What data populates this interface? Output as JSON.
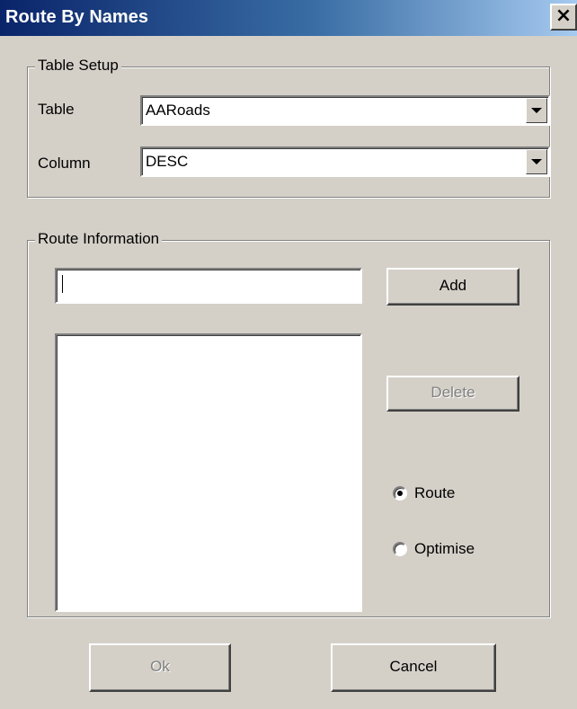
{
  "window": {
    "title": "Route By Names",
    "close_label": "×"
  },
  "table_setup": {
    "legend": "Table Setup",
    "table_label": "Table",
    "table_value": "AARoads",
    "column_label": "Column",
    "column_value": "DESC"
  },
  "route_info": {
    "legend": "Route Information",
    "name_input_value": "",
    "add_label": "Add",
    "delete_label": "Delete",
    "route_option_label": "Route",
    "optimise_option_label": "Optimise",
    "selected_option": "Route"
  },
  "footer": {
    "ok_label": "Ok",
    "cancel_label": "Cancel"
  }
}
